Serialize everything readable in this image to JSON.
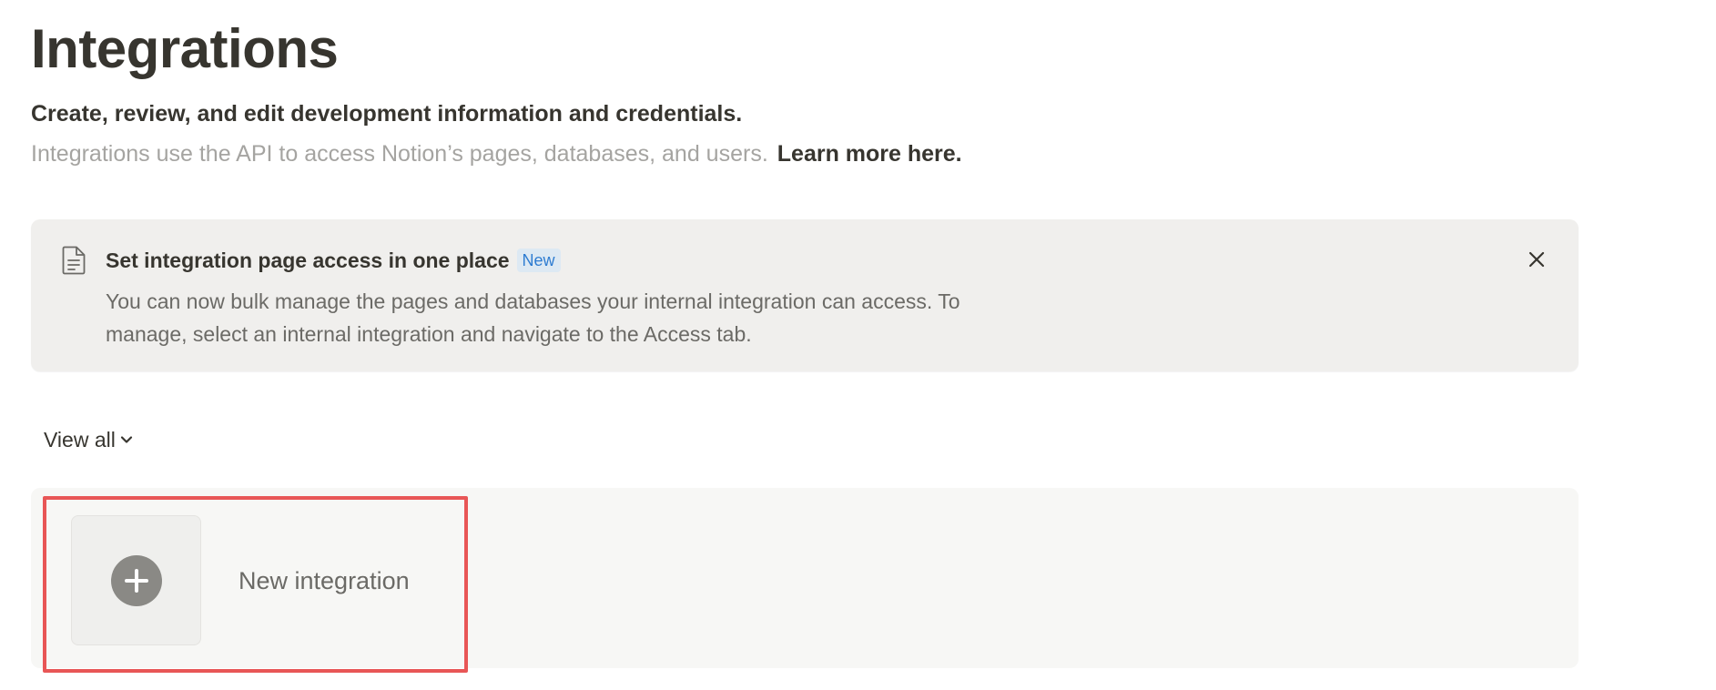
{
  "header": {
    "title": "Integrations",
    "subtitle": "Create, review, and edit development information and credentials.",
    "description": "Integrations use the API to access Notion’s pages, databases, and users.",
    "learn_more": "Learn more here."
  },
  "banner": {
    "icon": "document-icon",
    "title": "Set integration page access in one place",
    "badge": "New",
    "body": "You can now bulk manage the pages and databases your internal integration can access. To manage, select an internal integration and navigate to the Access tab.",
    "close_icon": "close-icon"
  },
  "filter": {
    "label": "View all",
    "icon": "chevron-down-icon"
  },
  "integrations": {
    "new_label": "New integration",
    "new_icon": "plus-circle-icon"
  },
  "colors": {
    "highlight": "#e85656",
    "badge_text": "#2e7cd1",
    "badge_bg": "#dde9f3",
    "banner_bg": "#f0efed",
    "muted_text": "#a5a4a1"
  }
}
